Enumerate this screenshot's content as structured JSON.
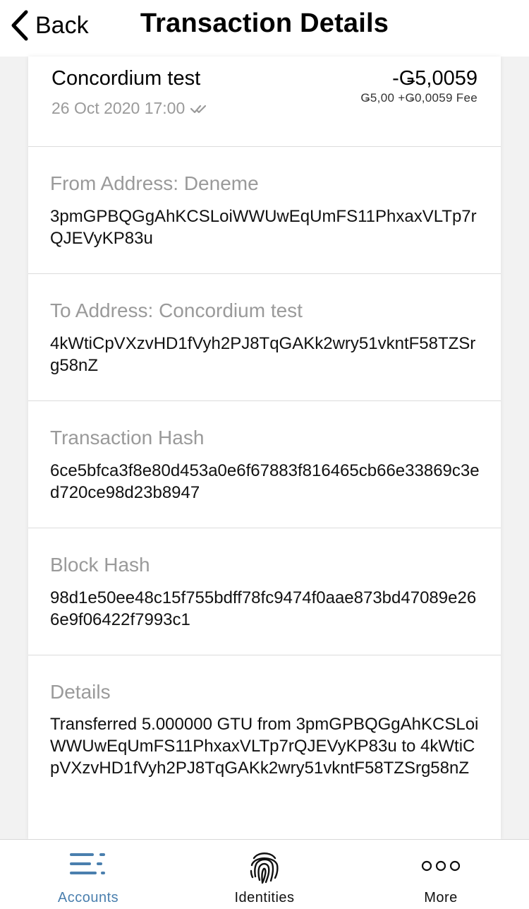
{
  "header": {
    "back_label": "Back",
    "title": "Transaction Details"
  },
  "summary": {
    "name": "Concordium test",
    "date": "26 Oct 2020 17:00",
    "amount": "-Ǥ5,0059",
    "breakdown": "Ǥ5,00 +Ǥ0,0059 Fee"
  },
  "sections": [
    {
      "label": "From Address: Deneme",
      "value": "3pmGPBQGgAhKCSLoiWWUwEqUmFS11PhxaxVLTp7rQJEVyKP83u"
    },
    {
      "label": "To Address: Concordium test",
      "value": "4kWtiCpVXzvHD1fVyh2PJ8TqGAKk2wry51vkntF58TZSrg58nZ"
    },
    {
      "label": "Transaction Hash",
      "value": "6ce5bfca3f8e80d453a0e6f67883f816465cb66e33869c3ed720ce98d23b8947"
    },
    {
      "label": "Block Hash",
      "value": "98d1e50ee48c15f755bdff78fc9474f0aae873bd47089e266e9f06422f7993c1"
    },
    {
      "label": "Details",
      "value": "Transferred 5.000000 GTU from 3pmGPBQGgAhKCSLoiWWUwEqUmFS11PhxaxVLTp7rQJEVyKP83u to 4kWtiCpVXzvHD1fVyh2PJ8TqGAKk2wry51vkntF58TZSrg58nZ"
    }
  ],
  "tabs": [
    {
      "label": "Accounts",
      "icon": "accounts-list-icon",
      "active": true
    },
    {
      "label": "Identities",
      "icon": "fingerprint-icon",
      "active": false
    },
    {
      "label": "More",
      "icon": "more-dots-icon",
      "active": false
    }
  ],
  "colors": {
    "accent": "#4a7fae",
    "muted_text": "#9a9a9a",
    "background": "#f2f2f2",
    "card": "#ffffff"
  }
}
